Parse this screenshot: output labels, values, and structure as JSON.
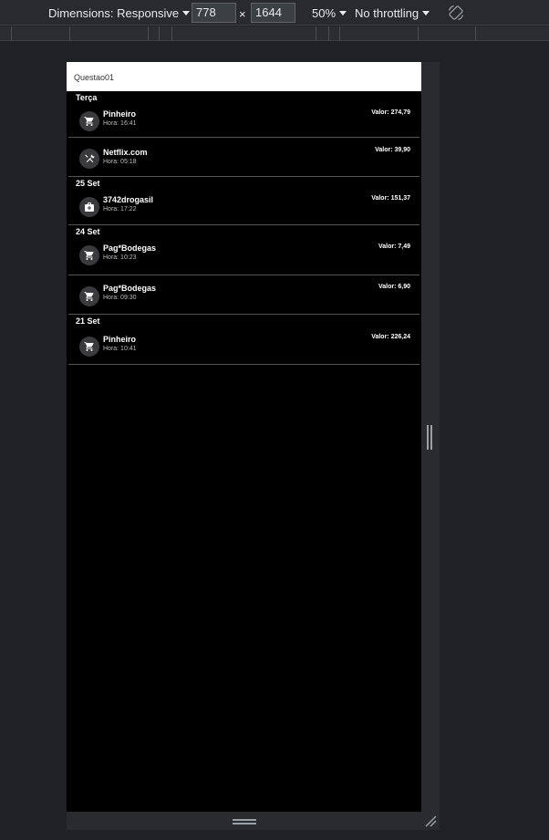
{
  "toolbar": {
    "dimensions_label": "Dimensions: Responsive",
    "width_value": "778",
    "times": "×",
    "height_value": "1644",
    "zoom": "50%",
    "throttling": "No throttling"
  },
  "app": {
    "title": "Questao01",
    "sections": [
      {
        "header": "Terça",
        "items": [
          {
            "icon": "cart-icon",
            "name": "Pinheiro",
            "time": "Hora: 16:41",
            "value": "Valor: 274,79"
          },
          {
            "icon": "tools-icon",
            "name": "Netflix.com",
            "time": "Hora: 05:18",
            "value": "Valor: 39,90"
          }
        ]
      },
      {
        "header": "25 Set",
        "items": [
          {
            "icon": "medkit-icon",
            "name": "3742drogasil",
            "time": "Hora: 17:22",
            "value": "Valor: 151,37"
          }
        ]
      },
      {
        "header": "24 Set",
        "items": [
          {
            "icon": "cart-icon",
            "name": "Pag*Bodegas",
            "time": "Hora: 10:23",
            "value": "Valor: 7,49"
          },
          {
            "icon": "cart-icon",
            "name": "Pag*Bodegas",
            "time": "Hora: 09:30",
            "value": "Valor: 6,90"
          }
        ]
      },
      {
        "header": "21 Set",
        "items": [
          {
            "icon": "cart-icon",
            "name": "Pinheiro",
            "time": "Hora: 10:41",
            "value": "Valor: 226,24"
          }
        ]
      }
    ]
  }
}
